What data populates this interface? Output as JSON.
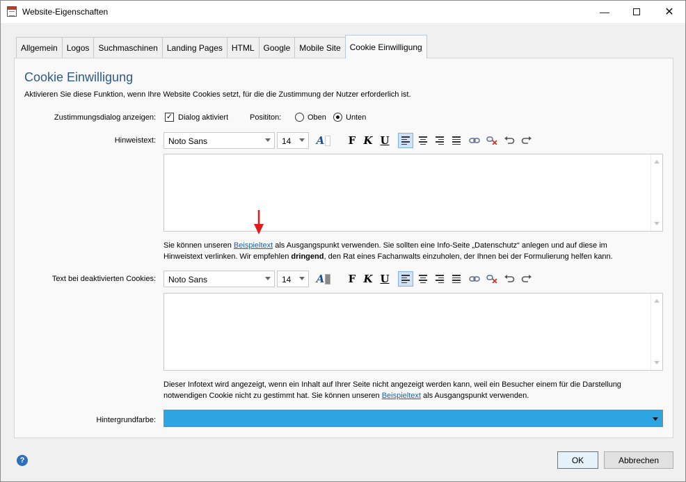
{
  "window": {
    "title": "Website-Eigenschaften"
  },
  "tabs": [
    {
      "label": "Allgemein"
    },
    {
      "label": "Logos"
    },
    {
      "label": "Suchmaschinen"
    },
    {
      "label": "Landing Pages"
    },
    {
      "label": "HTML"
    },
    {
      "label": "Google"
    },
    {
      "label": "Mobile Site"
    },
    {
      "label": "Cookie Einwilligung",
      "active": true
    }
  ],
  "panel": {
    "heading": "Cookie Einwilligung",
    "intro": "Aktivieren Sie diese Funktion, wenn Ihre Website Cookies setzt, für die die Zustimmung der Nutzer erforderlich ist.",
    "consent_label": "Zustimmungsdialog anzeigen:",
    "dialog_checkbox_label": "Dialog aktiviert",
    "dialog_checked": true,
    "position_label": "Posititon:",
    "position_top": "Oben",
    "position_bottom": "Unten",
    "position_selected": "Unten",
    "hint_label": "Hinweistext:",
    "font_value": "Noto Sans",
    "size_value": "14",
    "hint_info": {
      "part1": "Sie können unseren ",
      "link": "Beispieltext",
      "part2": " als Ausgangspunkt verwenden. Sie sollten eine Info-Seite „Datenschutz“ anlegen und auf diese im",
      "part3": "Hinweistext verlinken. Wir empfehlen ",
      "bold": "dringend",
      "part4": ", den Rat eines Fachanwalts einzuholen, der Ihnen bei der Formulierung helfen kann."
    },
    "disabled_label": "Text bei deaktivierten Cookies:",
    "disabled_info": {
      "part1": "Dieser Infotext wird angezeigt, wenn ein Inhalt auf Ihrer Seite nicht angezeigt werden kann, weil ein Besucher einem für die Darstellung",
      "part2": "notwendigen Cookie nicht zu gestimmt hat. Sie können unseren ",
      "link": "Beispieltext",
      "part3": " als Ausgangspunkt verwenden."
    },
    "bg_label": "Hintergrundfarbe:",
    "bg_color": "#2EA5E3"
  },
  "toolbar_icons": [
    "font-color-icon",
    "bold-icon",
    "italic-icon",
    "underline-icon",
    "align-left-icon",
    "align-center-icon",
    "align-right-icon",
    "justify-icon",
    "link-icon",
    "unlink-icon",
    "undo-icon",
    "redo-icon"
  ],
  "buttons": {
    "ok": "OK",
    "cancel": "Abbrechen"
  }
}
